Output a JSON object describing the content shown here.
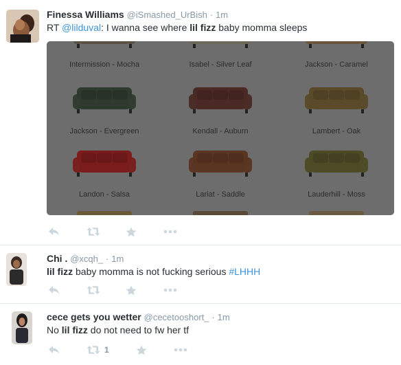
{
  "colors": {
    "name": "#292f33",
    "meta": "#8899a6",
    "link": "#3b94d9",
    "action_icon": "#ccd6dd",
    "divider": "#e1e8ed"
  },
  "tweets": [
    {
      "fullname": "Finessa Williams",
      "username": "@iSmashed_UrBish",
      "time": "1m",
      "rt_prefix": "RT ",
      "mention": "@lilduval",
      "text_a": ": I wanna see where ",
      "keyword": "lil fizz",
      "text_b": " baby momma sleeps",
      "media": {
        "sofas": [
          {
            "label": "Intermission - Mocha",
            "color": "#5a5144"
          },
          {
            "label": "Isabel - Silver Leaf",
            "color": "#6b6a58"
          },
          {
            "label": "Jackson - Caramel",
            "color": "#6a553b"
          },
          {
            "label": "Jackson - Evergreen",
            "color": "#2f3a2f"
          },
          {
            "label": "Kendall - Auburn",
            "color": "#4a2a24"
          },
          {
            "label": "Lambert - Oak",
            "color": "#5a4a2a"
          },
          {
            "label": "Landon - Salsa",
            "color": "#7a1c1c"
          },
          {
            "label": "Lariat - Saddle",
            "color": "#5a3521"
          },
          {
            "label": "Lauderhill - Moss",
            "color": "#4d4a26"
          }
        ]
      },
      "actions": {
        "retweet_count": "",
        "icons": [
          "reply-icon",
          "retweet-icon",
          "favorite-icon",
          "more-icon"
        ]
      }
    },
    {
      "fullname": "Chi .",
      "username": "@xcqh_",
      "time": "1m",
      "keyword": "lil fizz",
      "text_a": " baby momma is not fucking serious ",
      "hashtag": "#LHHH",
      "actions": {
        "retweet_count": "",
        "icons": [
          "reply-icon",
          "retweet-icon",
          "favorite-icon",
          "more-icon"
        ]
      }
    },
    {
      "fullname": "cece gets you wetter",
      "username": "@cecetooshort_",
      "time": "1m",
      "text_pre": "No ",
      "keyword": "lil fizz",
      "text_a": " do not need to fw her tf",
      "actions": {
        "retweet_count": "1",
        "icons": [
          "reply-icon",
          "retweet-icon",
          "favorite-icon",
          "more-icon"
        ]
      }
    }
  ]
}
